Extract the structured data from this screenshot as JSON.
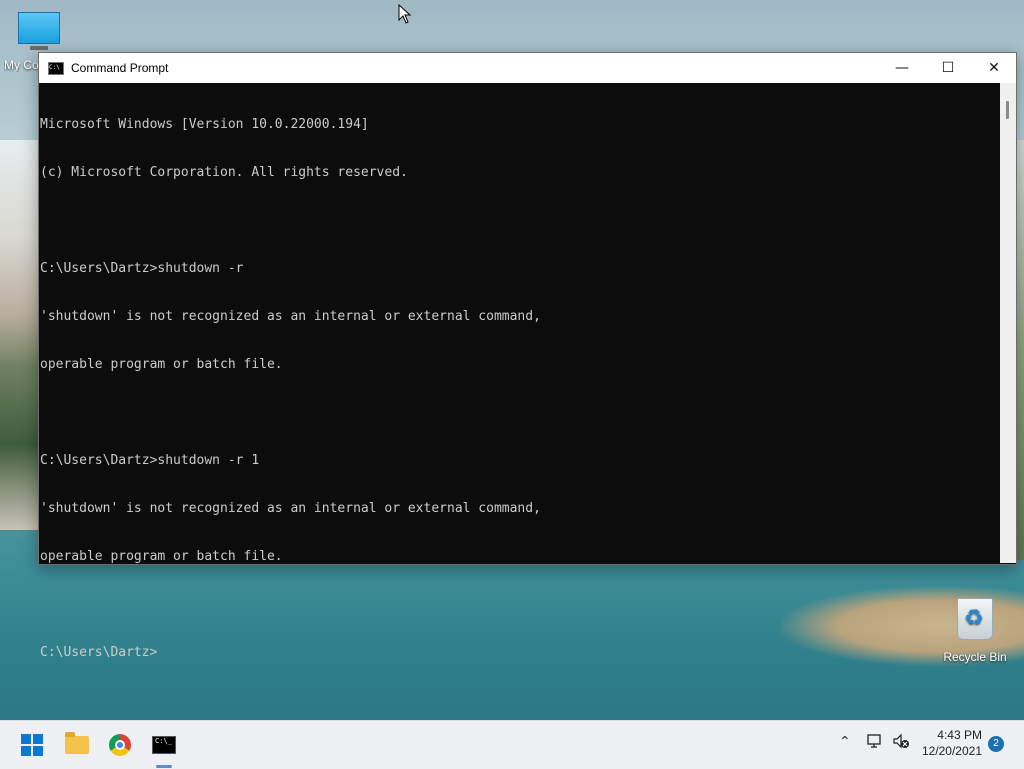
{
  "desktop": {
    "icons": [
      {
        "label": "My Co",
        "icon": "computer-icon"
      },
      {
        "label": "Recycle Bin",
        "icon": "recycle-bin-icon"
      }
    ]
  },
  "window": {
    "title": "Command Prompt",
    "icon": "cmd-icon",
    "icon_glyph": "C:\\",
    "buttons": {
      "minimize": "—",
      "maximize": "☐",
      "close": "✕"
    }
  },
  "console": {
    "lines": [
      "Microsoft Windows [Version 10.0.22000.194]",
      "(c) Microsoft Corporation. All rights reserved.",
      "",
      "C:\\Users\\Dartz>shutdown -r",
      "'shutdown' is not recognized as an internal or external command,",
      "operable program or batch file.",
      "",
      "C:\\Users\\Dartz>shutdown -r 1",
      "'shutdown' is not recognized as an internal or external command,",
      "operable program or batch file.",
      "",
      "C:\\Users\\Dartz>"
    ]
  },
  "taskbar": {
    "apps": [
      {
        "name": "start",
        "icon": "windows-start-icon"
      },
      {
        "name": "file-explorer",
        "icon": "folder-icon"
      },
      {
        "name": "chrome",
        "icon": "chrome-icon"
      },
      {
        "name": "command-prompt",
        "icon": "cmd-icon",
        "glyph": "C:\\_"
      }
    ],
    "tray": {
      "chevron": "⌃",
      "time": "4:43 PM",
      "date": "12/20/2021",
      "notifications": "2"
    }
  },
  "colors": {
    "console_bg": "#0c0c0c",
    "console_fg": "#cccccc",
    "accent": "#0a78d7"
  }
}
